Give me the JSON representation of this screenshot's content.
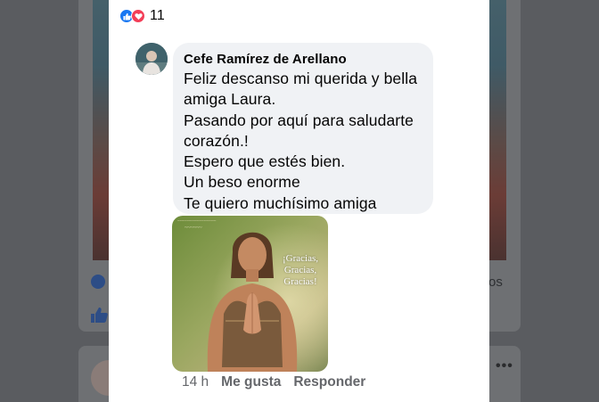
{
  "reactions": {
    "count": "11",
    "types": [
      "like-icon",
      "love-icon"
    ],
    "like_color": "#1877f2",
    "love_color": "#f33e58"
  },
  "comment": {
    "author": "Cefe Ramírez de Arellano",
    "lines": [
      "Feliz descanso mi querida y bella",
      "amiga Laura.",
      "Pasando por aquí para saludarte",
      "corazón.!",
      "Espero que estés bien.",
      "Un beso enorme",
      "Te quiero muchísimo amiga"
    ],
    "image": {
      "caption_lines": [
        "¡Gracias,",
        "Gracias,",
        "Gracias!"
      ]
    },
    "timestamp": "14 h",
    "like_label": "Me gusta",
    "reply_label": "Responder"
  },
  "background": {
    "partial_text": "os",
    "more_icon": "more-dots-icon"
  },
  "colors": {
    "bubble": "#f0f2f5",
    "action_text": "#65676b",
    "accent": "#1877f2"
  }
}
